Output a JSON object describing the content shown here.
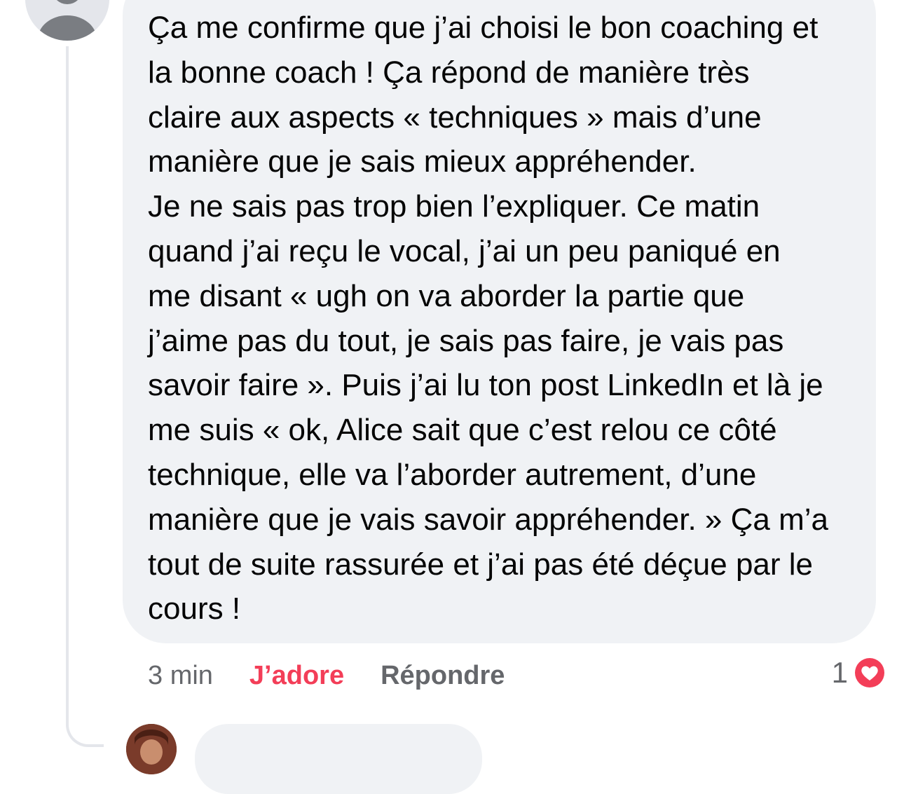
{
  "comment": {
    "text": "Ça me confirme que j’ai choisi le bon coaching et\nla bonne coach ! Ça répond de manière très\nclaire aux aspects « techniques » mais d’une\nmanière que je sais mieux appréhender.\nJe ne sais pas trop bien l’expliquer. Ce matin\nquand j’ai reçu le vocal, j’ai un peu paniqué en\nme disant « ugh on va aborder la partie que\nj’aime pas du tout, je sais pas faire, je vais pas\nsavoir faire ». Puis j’ai lu ton post LinkedIn et là je\nme suis « ok, Alice sait que c’est relou ce côté\ntechnique, elle va l’aborder autrement, d’une\nmanière que je vais savoir appréhender. » Ça m’a\ntout de suite rassurée et j’ai pas été déçue par le\ncours !",
    "time": "3 min",
    "love_label": "J’adore",
    "reply_label": "Répondre",
    "reaction_count": "1",
    "reaction_icon": "heart-icon"
  },
  "colors": {
    "bubble": "#f0f2f5",
    "love": "#f33e58",
    "muted": "#65676b",
    "text": "#050505"
  }
}
